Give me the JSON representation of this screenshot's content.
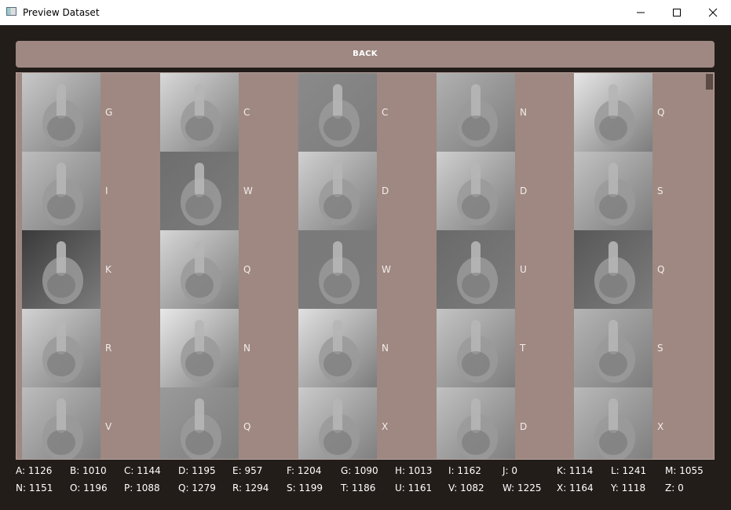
{
  "window": {
    "title": "Preview Dataset"
  },
  "back_label": "BACK",
  "colors": {
    "accent": "#9e8881",
    "background": "#231d1a"
  },
  "grid": {
    "rows": [
      [
        "G",
        "C",
        "C",
        "N",
        "Q"
      ],
      [
        "I",
        "W",
        "D",
        "D",
        "S"
      ],
      [
        "K",
        "Q",
        "W",
        "U",
        "Q"
      ],
      [
        "R",
        "N",
        "N",
        "T",
        "S"
      ],
      [
        "V",
        "Q",
        "X",
        "D",
        "X"
      ]
    ]
  },
  "counts": [
    [
      "A: 1126",
      "B: 1010",
      "C: 1144",
      "D: 1195",
      "E: 957",
      "F: 1204",
      "G: 1090",
      "H: 1013",
      "I: 1162",
      "J: 0",
      "K: 1114",
      "L: 1241",
      "M: 1055"
    ],
    [
      "N: 1151",
      "O: 1196",
      "P: 1088",
      "Q: 1279",
      "R: 1294",
      "S: 1199",
      "T: 1186",
      "U: 1161",
      "V: 1082",
      "W: 1225",
      "X: 1164",
      "Y: 1118",
      "Z: 0"
    ]
  ]
}
